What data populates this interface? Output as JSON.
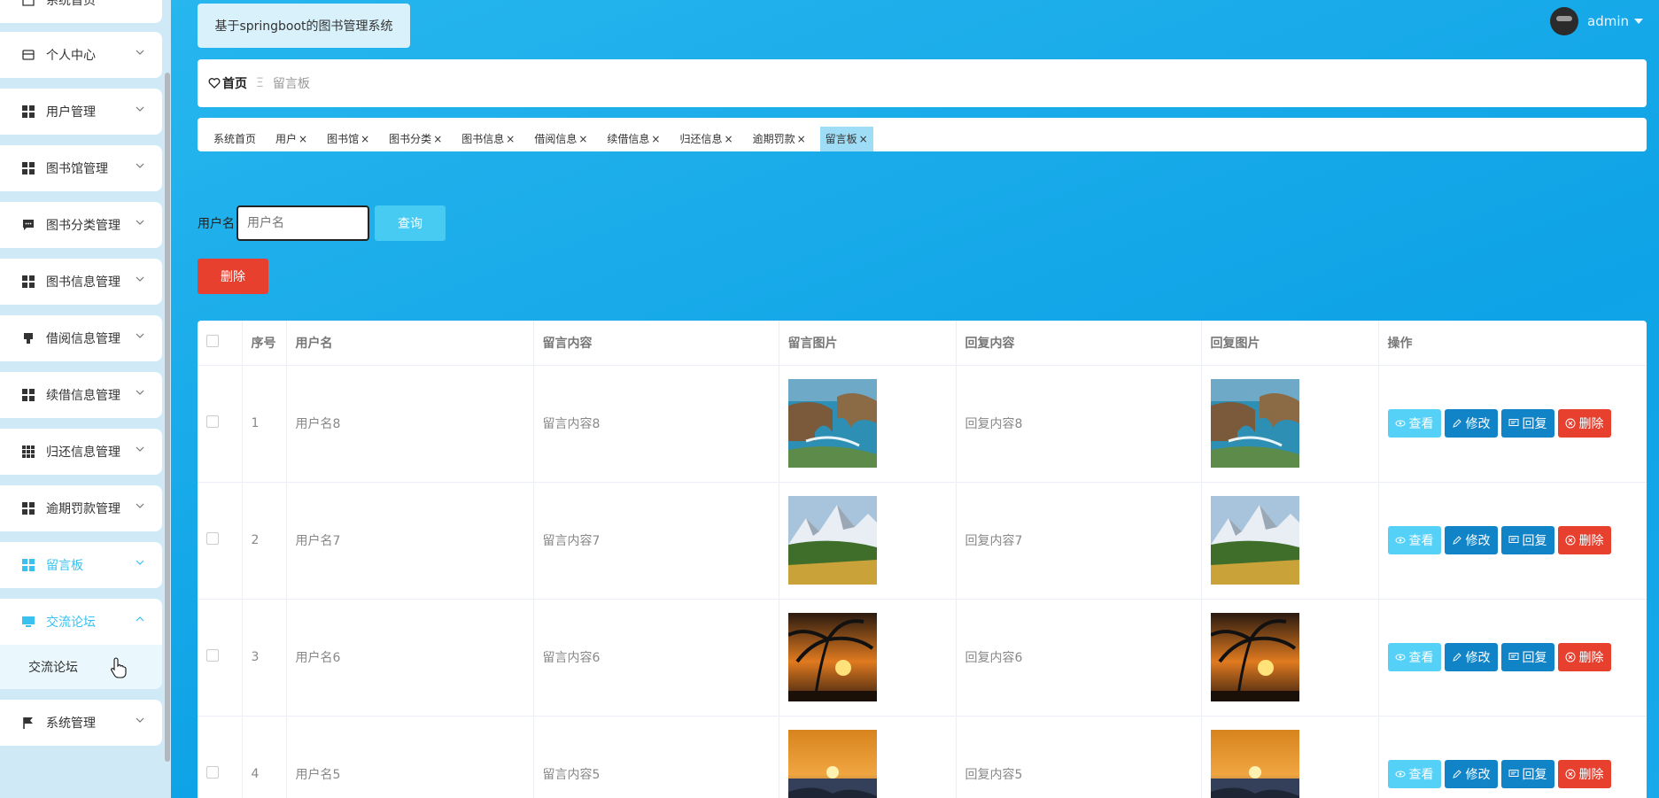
{
  "app": {
    "title": "基于springboot的图书管理系统"
  },
  "user": {
    "name": "admin"
  },
  "sidebar": {
    "items": [
      {
        "label": "系统首页",
        "icon": "home-icon"
      },
      {
        "label": "个人中心",
        "icon": "card-icon"
      },
      {
        "label": "用户管理",
        "icon": "grid-icon"
      },
      {
        "label": "图书馆管理",
        "icon": "grid-icon"
      },
      {
        "label": "图书分类管理",
        "icon": "chat-icon"
      },
      {
        "label": "图书信息管理",
        "icon": "grid-icon"
      },
      {
        "label": "借阅信息管理",
        "icon": "stamp-icon"
      },
      {
        "label": "续借信息管理",
        "icon": "grid-icon"
      },
      {
        "label": "归还信息管理",
        "icon": "dots-grid-icon"
      },
      {
        "label": "逾期罚款管理",
        "icon": "grid-icon"
      },
      {
        "label": "留言板",
        "icon": "grid-icon"
      },
      {
        "label": "交流论坛",
        "icon": "monitor-icon"
      },
      {
        "label": "系统管理",
        "icon": "flag-icon"
      }
    ],
    "submenu_label": "交流论坛"
  },
  "breadcrumb": {
    "home": "首页",
    "separator": "Ξ",
    "current": "留言板"
  },
  "tags": [
    "系统首页",
    "用户",
    "图书馆",
    "图书分类",
    "图书信息",
    "借阅信息",
    "续借信息",
    "归还信息",
    "逾期罚款",
    "留言板"
  ],
  "search": {
    "label": "用户名",
    "placeholder": "用户名",
    "button": "查询"
  },
  "toolbar": {
    "delete": "删除"
  },
  "table": {
    "headers": [
      "序号",
      "用户名",
      "留言内容",
      "留言图片",
      "回复内容",
      "回复图片",
      "操作"
    ],
    "rows": [
      {
        "index": "1",
        "username": "用户名8",
        "message": "留言内容8",
        "reply": "回复内容8",
        "image": "sea-arch"
      },
      {
        "index": "2",
        "username": "用户名7",
        "message": "留言内容7",
        "reply": "回复内容7",
        "image": "snow-mountain"
      },
      {
        "index": "3",
        "username": "用户名6",
        "message": "留言内容6",
        "reply": "回复内容6",
        "image": "palm-sunset"
      },
      {
        "index": "4",
        "username": "用户名5",
        "message": "留言内容5",
        "reply": "回复内容5",
        "image": "ocean-sunset"
      }
    ],
    "actions": {
      "view": "查看",
      "edit": "修改",
      "reply": "回复",
      "delete": "删除"
    }
  },
  "colors": {
    "accent": "#39c2f0",
    "primary": "#1183c7",
    "danger": "#e8402f",
    "light_btn": "#55d0f6"
  }
}
